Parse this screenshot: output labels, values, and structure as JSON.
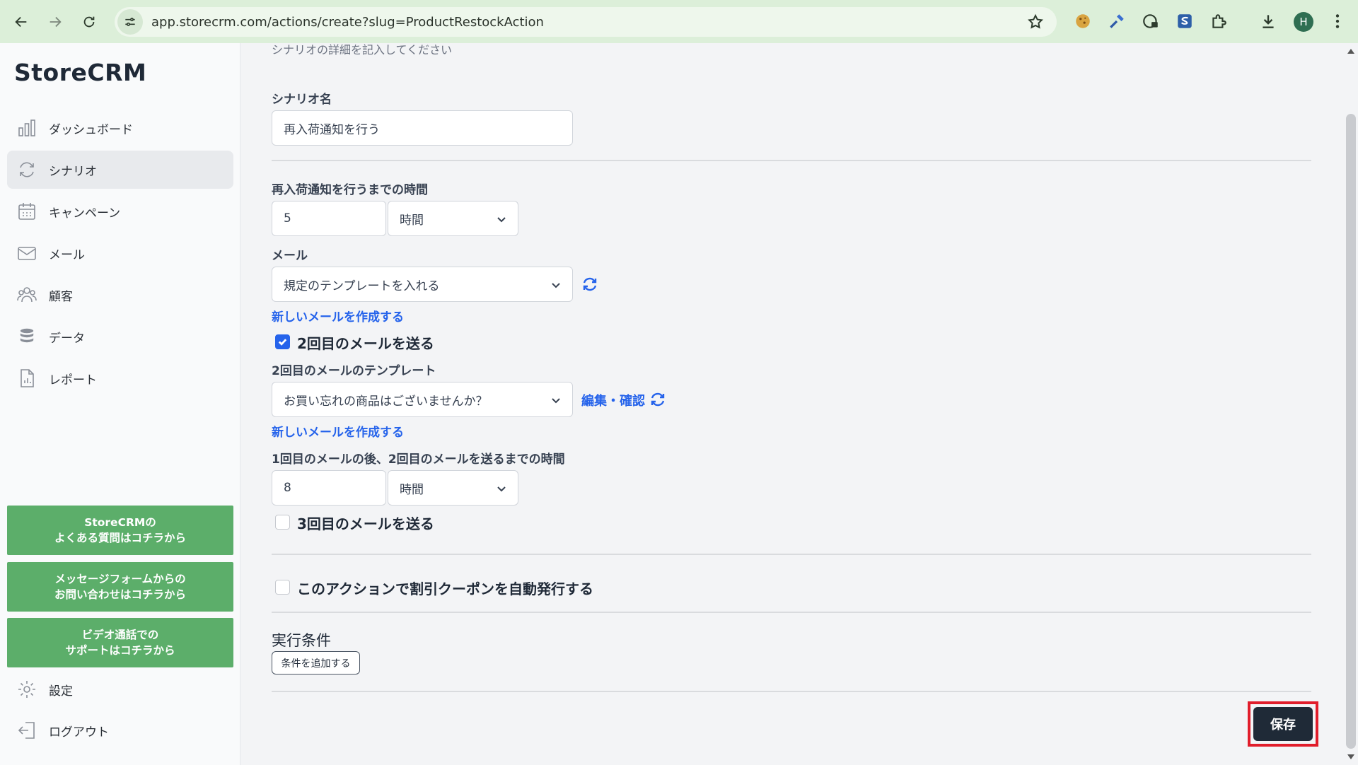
{
  "browser": {
    "url": "app.storecrm.com/actions/create?slug=ProductRestockAction",
    "profile_initial": "H"
  },
  "sidebar": {
    "logo": "StoreCRM",
    "items": [
      {
        "label": "ダッシュボード",
        "icon": "bar-chart-icon"
      },
      {
        "label": "シナリオ",
        "icon": "refresh-cycle-icon"
      },
      {
        "label": "キャンペーン",
        "icon": "calendar-icon"
      },
      {
        "label": "メール",
        "icon": "mail-icon"
      },
      {
        "label": "顧客",
        "icon": "users-icon"
      },
      {
        "label": "データ",
        "icon": "database-icon"
      },
      {
        "label": "レポート",
        "icon": "report-icon"
      }
    ],
    "help_buttons": [
      {
        "line1": "StoreCRMの",
        "line2": "よくある質問はコチラから"
      },
      {
        "line1": "メッセージフォームからの",
        "line2": "お問い合わせはコチラから"
      },
      {
        "line1": "ビデオ通話での",
        "line2": "サポートはコチラから"
      }
    ],
    "settings_label": "設定",
    "logout_label": "ログアウト"
  },
  "form": {
    "description_hint": "シナリオの詳細を記入してください",
    "scenario_name_label": "シナリオ名",
    "scenario_name_value": "再入荷通知を行う",
    "delay_label": "再入荷通知を行うまでの時間",
    "delay_value": "5",
    "delay_unit": "時間",
    "mail_label": "メール",
    "mail_template_value": "規定のテンプレートを入れる",
    "new_mail_link": "新しいメールを作成する",
    "second_mail_checkbox_label": "2回目のメールを送る",
    "second_mail_checked": true,
    "second_template_label": "2回目のメールのテンプレート",
    "second_template_value": "お買い忘れの商品はございませんか？",
    "edit_confirm_link": "編集・確認",
    "new_mail_link_2": "新しいメールを作成する",
    "second_delay_label": "1回目のメールの後、2回目のメールを送るまでの時間",
    "second_delay_value": "8",
    "second_delay_unit": "時間",
    "third_mail_checkbox_label": "3回目のメールを送る",
    "third_mail_checked": false,
    "coupon_checkbox_label": "このアクションで割引クーポンを自動発行する",
    "coupon_checked": false,
    "conditions_label": "実行条件",
    "add_condition_button": "条件を追加する",
    "save_button": "保存"
  },
  "colors": {
    "accent_blue": "#2563eb",
    "help_green": "#5cae6a",
    "save_dark": "#1f2a37",
    "highlight_red": "#e11d2b",
    "browser_green": "#dcefd9"
  }
}
